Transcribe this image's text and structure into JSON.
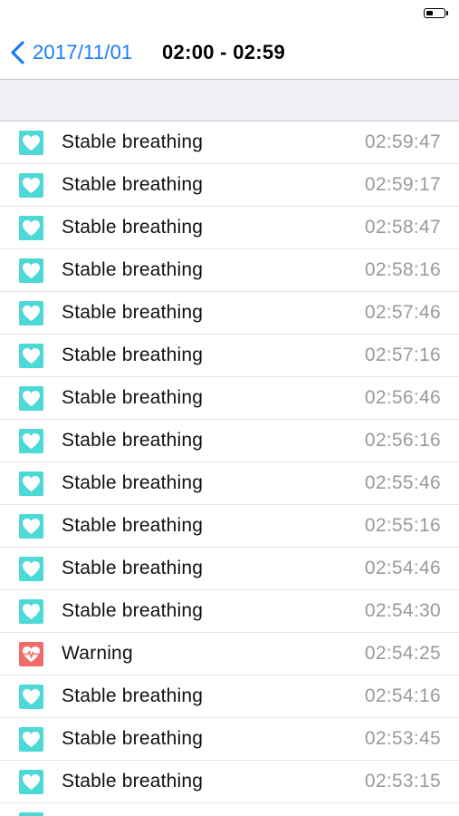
{
  "status_bar": {
    "battery_level": 0.4
  },
  "nav": {
    "back_label": "2017/11/01",
    "title": "02:00 - 02:59"
  },
  "colors": {
    "stable": "#4dd9d5",
    "warning": "#f26b6b",
    "accent": "#1a7cf5"
  },
  "rows": [
    {
      "type": "stable",
      "icon": "heart-icon",
      "label": "Stable breathing",
      "time": "02:59:47"
    },
    {
      "type": "stable",
      "icon": "heart-icon",
      "label": "Stable breathing",
      "time": "02:59:17"
    },
    {
      "type": "stable",
      "icon": "heart-icon",
      "label": "Stable breathing",
      "time": "02:58:47"
    },
    {
      "type": "stable",
      "icon": "heart-icon",
      "label": "Stable breathing",
      "time": "02:58:16"
    },
    {
      "type": "stable",
      "icon": "heart-icon",
      "label": "Stable breathing",
      "time": "02:57:46"
    },
    {
      "type": "stable",
      "icon": "heart-icon",
      "label": "Stable breathing",
      "time": "02:57:16"
    },
    {
      "type": "stable",
      "icon": "heart-icon",
      "label": "Stable breathing",
      "time": "02:56:46"
    },
    {
      "type": "stable",
      "icon": "heart-icon",
      "label": "Stable breathing",
      "time": "02:56:16"
    },
    {
      "type": "stable",
      "icon": "heart-icon",
      "label": "Stable breathing",
      "time": "02:55:46"
    },
    {
      "type": "stable",
      "icon": "heart-icon",
      "label": "Stable breathing",
      "time": "02:55:16"
    },
    {
      "type": "stable",
      "icon": "heart-icon",
      "label": "Stable breathing",
      "time": "02:54:46"
    },
    {
      "type": "stable",
      "icon": "heart-icon",
      "label": "Stable breathing",
      "time": "02:54:30"
    },
    {
      "type": "warning",
      "icon": "heart-pulse-icon",
      "label": "Warning",
      "time": "02:54:25"
    },
    {
      "type": "stable",
      "icon": "heart-icon",
      "label": "Stable breathing",
      "time": "02:54:16"
    },
    {
      "type": "stable",
      "icon": "heart-icon",
      "label": "Stable breathing",
      "time": "02:53:45"
    },
    {
      "type": "stable",
      "icon": "heart-icon",
      "label": "Stable breathing",
      "time": "02:53:15"
    },
    {
      "type": "stable",
      "icon": "heart-icon",
      "label": "",
      "time": ""
    }
  ]
}
